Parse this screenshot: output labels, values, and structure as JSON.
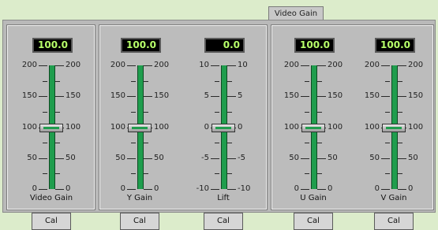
{
  "tab": {
    "label": "Video Gain"
  },
  "sliders": [
    {
      "readout": "100.0",
      "name": "Video Gain",
      "scale": [
        "200",
        "150",
        "100",
        "50",
        "0"
      ],
      "value_fraction": 0.5,
      "cal_label": "Cal"
    },
    {
      "readout": "100.0",
      "name": "Y Gain",
      "scale": [
        "200",
        "150",
        "100",
        "50",
        "0"
      ],
      "value_fraction": 0.5,
      "cal_label": "Cal"
    },
    {
      "readout": "0.0",
      "name": "Lift",
      "scale": [
        "10",
        "5",
        "0",
        "-5",
        "-10"
      ],
      "value_fraction": 0.5,
      "cal_label": "Cal"
    },
    {
      "readout": "100.0",
      "name": "U Gain",
      "scale": [
        "200",
        "150",
        "100",
        "50",
        "0"
      ],
      "value_fraction": 0.5,
      "cal_label": "Cal"
    },
    {
      "readout": "100.0",
      "name": "V Gain",
      "scale": [
        "200",
        "150",
        "100",
        "50",
        "0"
      ],
      "value_fraction": 0.5,
      "cal_label": "Cal"
    }
  ]
}
